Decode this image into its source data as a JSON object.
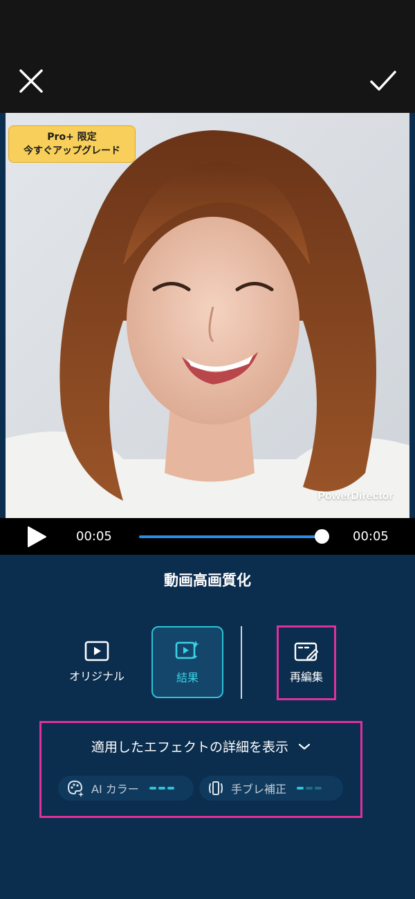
{
  "topbar": {
    "close_icon": "close-icon",
    "confirm_icon": "checkmark-icon"
  },
  "preview": {
    "badge_line1": "Pro+ 限定",
    "badge_line2": "今すぐアップグレード",
    "watermark": "PowerDirector"
  },
  "player": {
    "current_time": "00:05",
    "total_time": "00:05",
    "progress": 1.0,
    "accent_color": "#2a8be8"
  },
  "panel": {
    "title": "動画高画質化",
    "modes": [
      {
        "label": "オリジナル",
        "icon": "play-box-icon",
        "selected": false
      },
      {
        "label": "結果",
        "icon": "enhanced-video-icon",
        "selected": true
      },
      {
        "label": "再編集",
        "icon": "edit-frame-icon",
        "selected": false
      }
    ],
    "effects_toggle": "適用したエフェクトの詳細を表示",
    "effects": [
      {
        "label": "AI カラー",
        "icon": "palette-sparkle-icon",
        "level": "3/3"
      },
      {
        "label": "手ブレ補正",
        "icon": "stabilize-icon",
        "level": "1/3"
      }
    ],
    "selected_color": "#2ec3d6",
    "highlight_color": "#e0309a"
  }
}
